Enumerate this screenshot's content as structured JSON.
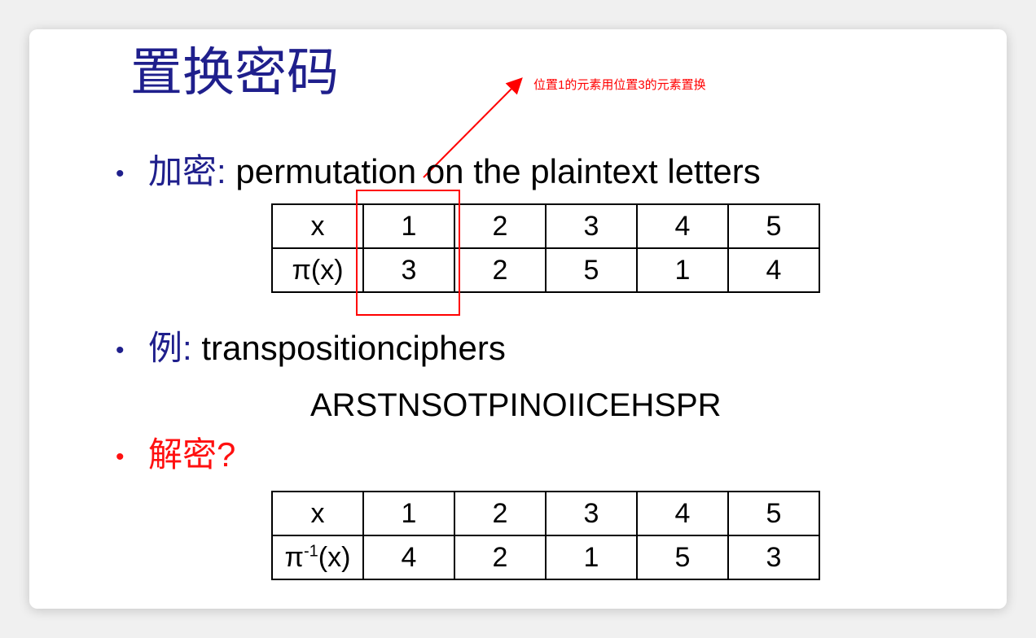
{
  "slide": {
    "title": "置换密码",
    "annotation": "位置1的元素用位置3的元素置换",
    "bullet1": {
      "cn": "加密",
      "sep": ":",
      "text": " permutation on the plaintext letters"
    },
    "table1": {
      "row1": [
        "x",
        "1",
        "2",
        "3",
        "4",
        "5"
      ],
      "row2_label": "π(x)",
      "row2": [
        "3",
        "2",
        "5",
        "1",
        "4"
      ]
    },
    "bullet2": {
      "cn": "例",
      "sep": ":",
      "text": " transpositionciphers"
    },
    "ciphertext": "ARSTNSOTPINOIICEHSPR",
    "bullet3": {
      "text": "解密?"
    },
    "table2": {
      "row1": [
        "x",
        "1",
        "2",
        "3",
        "4",
        "5"
      ],
      "row2_label_base": "π",
      "row2_label_sup": "-1",
      "row2_label_tail": "(x)",
      "row2": [
        "4",
        "2",
        "1",
        "5",
        "3"
      ]
    }
  },
  "colors": {
    "title": "#1f1f8c",
    "accent": "#ff1010",
    "annotation": "#ff0000"
  }
}
